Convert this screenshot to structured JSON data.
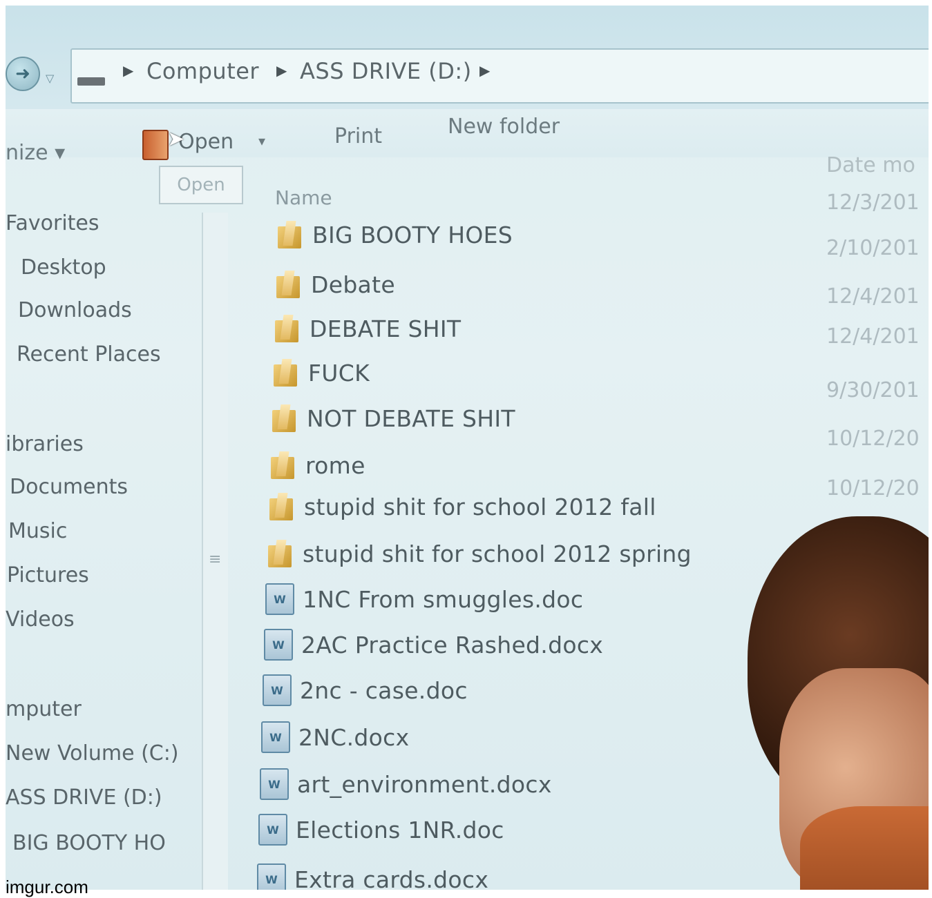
{
  "address_bar": {
    "breadcrumbs": [
      "Computer",
      "ASS DRIVE (D:)"
    ],
    "icons": [
      "back-arrow-icon",
      "dropdown-icon",
      "drive-icon",
      "chevron-right-icon"
    ]
  },
  "toolbar": {
    "organize_label": "nize ▾",
    "open_label": "Open",
    "open_dropdown": "▾",
    "print_label": "Print",
    "new_folder_label": "New folder",
    "tooltip": "Open"
  },
  "nav_pane": {
    "items": [
      "Favorites",
      "Desktop",
      "Downloads",
      "Recent Places",
      "ibraries",
      "Documents",
      "Music",
      "Pictures",
      "Videos",
      "mputer",
      "New Volume (C:)",
      "ASS DRIVE (D:)",
      "BIG BOOTY HO"
    ]
  },
  "file_list": {
    "columns": {
      "name": "Name",
      "date": "Date mo"
    },
    "rows": [
      {
        "name": "BIG BOOTY HOES",
        "type": "folder",
        "date": "12/3/201"
      },
      {
        "name": "Debate",
        "type": "folder",
        "date": "2/10/201"
      },
      {
        "name": "DEBATE SHIT",
        "type": "folder",
        "date": "12/4/201"
      },
      {
        "name": "FUCK",
        "type": "folder",
        "date": "12/4/201"
      },
      {
        "name": "NOT DEBATE SHIT",
        "type": "folder",
        "date": "9/30/201"
      },
      {
        "name": "rome",
        "type": "folder",
        "date": "10/12/20"
      },
      {
        "name": "stupid shit for school 2012 fall",
        "type": "folder",
        "date": "10/12/20"
      },
      {
        "name": "stupid shit for school 2012 spring",
        "type": "folder",
        "date": ""
      },
      {
        "name": "1NC From smuggles.doc",
        "type": "doc",
        "date": ""
      },
      {
        "name": "2AC Practice Rashed.docx",
        "type": "doc",
        "date": ""
      },
      {
        "name": "2nc - case.doc",
        "type": "doc",
        "date": ""
      },
      {
        "name": "2NC.docx",
        "type": "doc",
        "date": ""
      },
      {
        "name": "art_environment.docx",
        "type": "doc",
        "date": ""
      },
      {
        "name": "Elections 1NR.doc",
        "type": "doc",
        "date": ""
      },
      {
        "name": "Extra cards.docx",
        "type": "doc",
        "date": ""
      }
    ]
  },
  "watermark": "imgur.com",
  "colors": {
    "screen_bg": "#e2eff2",
    "text": "#4e5b60",
    "folder": "#e3b960",
    "doc_icon": "#5f8aa5"
  }
}
